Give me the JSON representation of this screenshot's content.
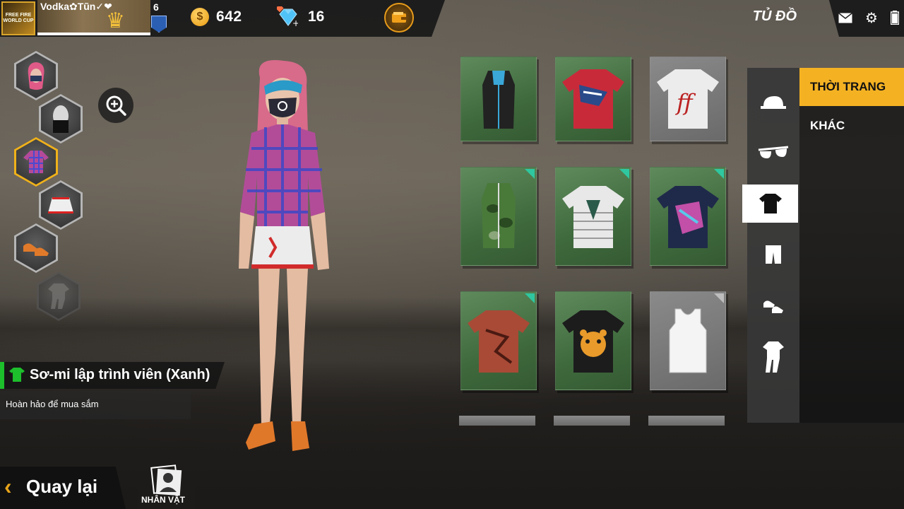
{
  "header": {
    "username": "Vodka✿Tũn✓❤",
    "level": "6",
    "avatar_text": "FREE FIRE\nWORLD CUP",
    "coins": "642",
    "diamonds": "16",
    "screen_title": "TỦ ĐỒ"
  },
  "icons": {
    "mail": "mail-icon",
    "settings": "gear-icon",
    "battery": "battery-icon"
  },
  "item": {
    "name": "Sơ-mi lập trình viên (Xanh)",
    "description": "Hoàn hảo để mua sắm"
  },
  "categories": {
    "selected": "shirt",
    "list": [
      "cap",
      "glasses",
      "shirt",
      "pants",
      "shoes",
      "full-outfit"
    ]
  },
  "sub_tabs": [
    "THỜI TRANG",
    "KHÁC"
  ],
  "footer": {
    "back_label": "Quay lại",
    "character_tab": "NHÂN VẬT"
  },
  "colors": {
    "accent": "#f4b223",
    "rarity_green": "#3f6a3d",
    "name_bar": "#1dbf2c"
  }
}
